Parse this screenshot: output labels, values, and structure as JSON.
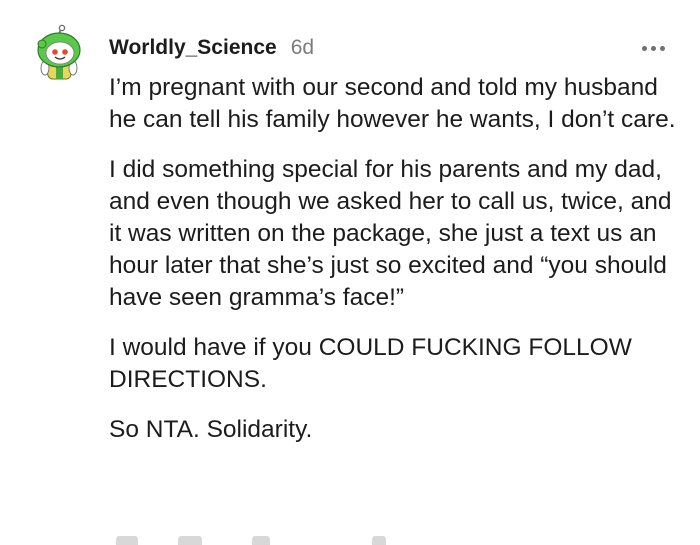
{
  "comment": {
    "username": "Worldly_Science",
    "age": "6d",
    "paragraphs": [
      "I’m pregnant with our second and told my husband he can tell his family however he wants, I don’t care.",
      "I did something special for his parents and my dad, and even though we asked her to call us, twice, and it was written on the package, she just a text us an hour later that she’s just so excited and “you should have seen gramma’s face!”",
      "I would have if you COULD FUCKING FOLLOW DIRECTIONS.",
      "So NTA. Solidarity."
    ]
  },
  "icons": {
    "avatar": "snoo-avatar-icon",
    "more": "more-options-icon"
  }
}
